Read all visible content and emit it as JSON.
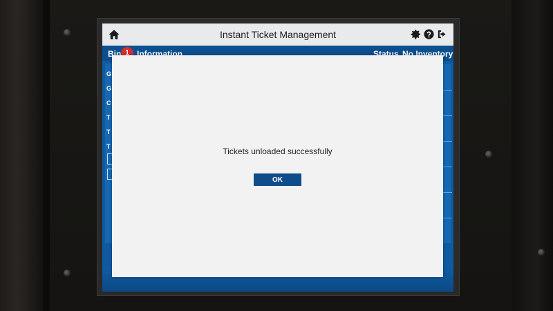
{
  "header": {
    "title": "Instant Ticket Management",
    "icons": [
      "home-icon",
      "gear-icon",
      "help-icon",
      "logout-icon"
    ]
  },
  "info_bar": {
    "bin_label": "Bin",
    "badge_count": "1",
    "info_label": "Information",
    "status_label": "Status",
    "status_value": "No Inventory"
  },
  "background_rows": [
    "G",
    "G",
    "C",
    "T",
    "T",
    "T"
  ],
  "dialog": {
    "message": "Tickets unloaded successfully",
    "ok_label": "OK"
  },
  "colors": {
    "screen_blue": "#0f5aa0",
    "button_blue": "#0f4c8a",
    "badge_red": "#d62d2d",
    "dialog_bg": "#f2f2f2",
    "header_bg": "#e9eaec"
  }
}
